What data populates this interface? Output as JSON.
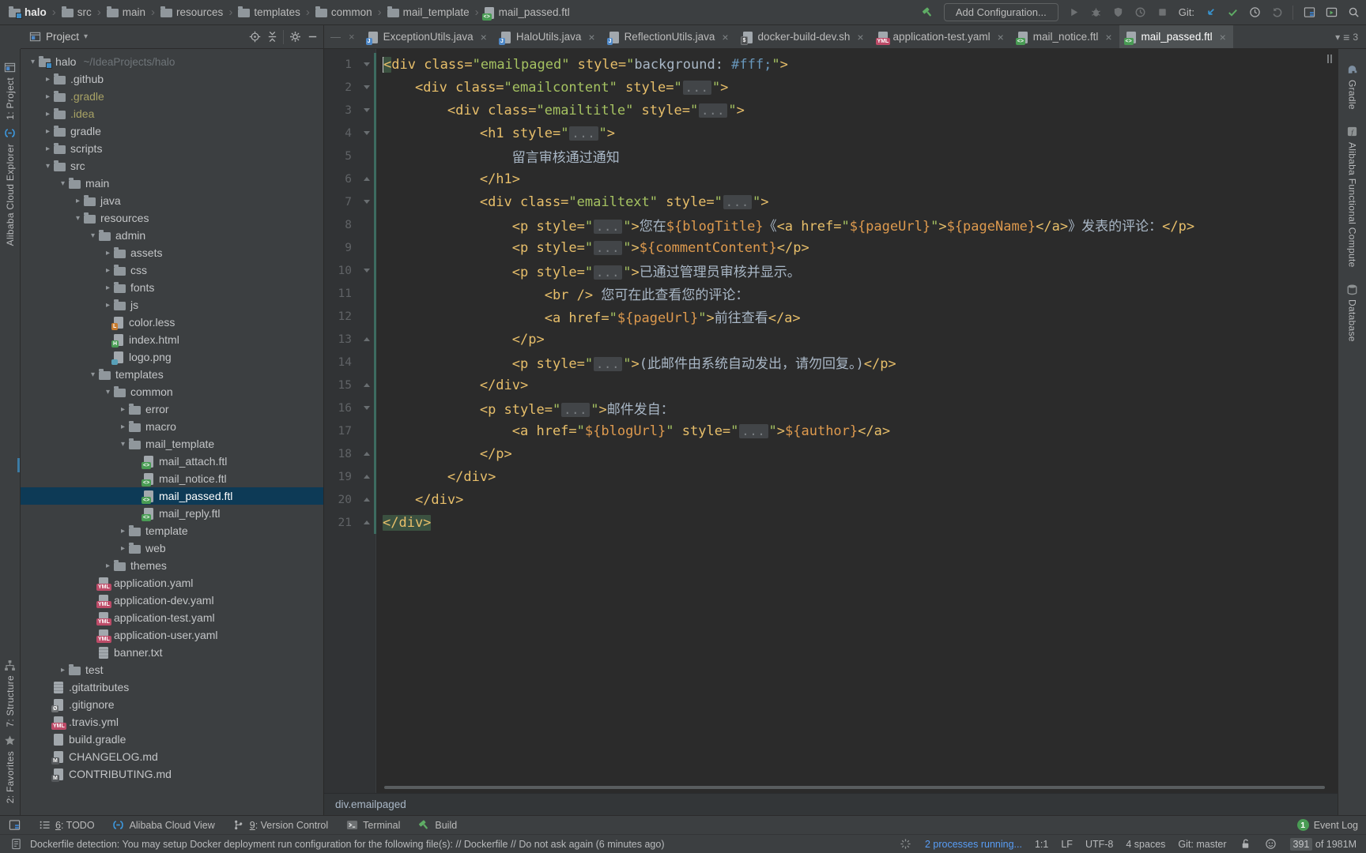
{
  "colors": {
    "ui_bg": "#3c3f41",
    "editor_bg": "#2b2b2b",
    "gutter_bg": "#313335",
    "tree_selection": "#0d3a56",
    "tab_active_bg": "#4e5254",
    "tag": "#e8bf6a",
    "string": "#a5c261",
    "plain_text": "#a9b7c6",
    "interpolation": "#de9a4e",
    "number": "#6897bb",
    "vcs_added_stripe": "#3d6b60",
    "accent_green": "#499C54",
    "accent_blue": "#3d9ae1",
    "link_blue": "#589df6",
    "excluded_folder": "#a8a265",
    "status_red_badge": "#bd4b68"
  },
  "main_toolbar": {
    "breadcrumb": {
      "items": [
        {
          "label": "halo",
          "icon": "project-folder-icon",
          "root": true
        },
        {
          "label": "src",
          "icon": "folder-icon"
        },
        {
          "label": "main",
          "icon": "folder-icon"
        },
        {
          "label": "resources",
          "icon": "folder-icon"
        },
        {
          "label": "templates",
          "icon": "folder-icon"
        },
        {
          "label": "common",
          "icon": "folder-icon"
        },
        {
          "label": "mail_template",
          "icon": "folder-icon"
        },
        {
          "label": "mail_passed.ftl",
          "icon": "file-ftl"
        }
      ]
    },
    "add_configuration": "Add Configuration...",
    "git_label": "Git:"
  },
  "tab_bar": {
    "remnant_close": "×",
    "tabs": [
      {
        "label": "ExceptionUtils.java",
        "icon": "file-java",
        "close": "×"
      },
      {
        "label": "HaloUtils.java",
        "icon": "file-java",
        "close": "×"
      },
      {
        "label": "ReflectionUtils.java",
        "icon": "file-java",
        "close": "×"
      },
      {
        "label": "docker-build-dev.sh",
        "icon": "file-sh",
        "close": "×"
      },
      {
        "label": "application-test.yaml",
        "icon": "file-yml",
        "close": "×"
      },
      {
        "label": "mail_notice.ftl",
        "icon": "file-ftl",
        "close": "×"
      },
      {
        "label": "mail_passed.ftl",
        "icon": "file-ftl",
        "close": "×",
        "active": true
      }
    ],
    "overflow": {
      "arrow": "▾",
      "count": "3"
    }
  },
  "project_panel": {
    "header": {
      "title": "Project",
      "caret": "▾"
    },
    "tree": [
      {
        "label": "halo",
        "level": 0,
        "icon": "project-folder-icon",
        "arrow": "exp",
        "hint": "~/IdeaProjects/halo"
      },
      {
        "label": ".github",
        "level": 1,
        "icon": "folder-icon",
        "arrow": "col"
      },
      {
        "label": ".gradle",
        "level": 1,
        "icon": "folder-icon",
        "arrow": "col",
        "excluded": true
      },
      {
        "label": ".idea",
        "level": 1,
        "icon": "folder-icon",
        "arrow": "col",
        "excluded": true
      },
      {
        "label": "gradle",
        "level": 1,
        "icon": "folder-icon",
        "arrow": "col"
      },
      {
        "label": "scripts",
        "level": 1,
        "icon": "folder-icon",
        "arrow": "col"
      },
      {
        "label": "src",
        "level": 1,
        "icon": "folder-icon",
        "arrow": "exp"
      },
      {
        "label": "main",
        "level": 2,
        "icon": "folder-icon",
        "arrow": "exp"
      },
      {
        "label": "java",
        "level": 3,
        "icon": "folder-icon",
        "arrow": "col"
      },
      {
        "label": "resources",
        "level": 3,
        "icon": "folder-icon",
        "arrow": "exp"
      },
      {
        "label": "admin",
        "level": 4,
        "icon": "folder-icon",
        "arrow": "exp"
      },
      {
        "label": "assets",
        "level": 5,
        "icon": "folder-icon",
        "arrow": "col"
      },
      {
        "label": "css",
        "level": 5,
        "icon": "folder-icon",
        "arrow": "col"
      },
      {
        "label": "fonts",
        "level": 5,
        "icon": "folder-icon",
        "arrow": "col"
      },
      {
        "label": "js",
        "level": 5,
        "icon": "folder-icon",
        "arrow": "col"
      },
      {
        "label": "color.less",
        "level": 5,
        "icon": "file-less"
      },
      {
        "label": "index.html",
        "level": 5,
        "icon": "file-html"
      },
      {
        "label": "logo.png",
        "level": 5,
        "icon": "file-img"
      },
      {
        "label": "templates",
        "level": 4,
        "icon": "folder-icon",
        "arrow": "exp"
      },
      {
        "label": "common",
        "level": 5,
        "icon": "folder-icon",
        "arrow": "exp"
      },
      {
        "label": "error",
        "level": 6,
        "icon": "folder-icon",
        "arrow": "col"
      },
      {
        "label": "macro",
        "level": 6,
        "icon": "folder-icon",
        "arrow": "col"
      },
      {
        "label": "mail_template",
        "level": 6,
        "icon": "folder-icon",
        "arrow": "exp"
      },
      {
        "label": "mail_attach.ftl",
        "level": 7,
        "icon": "file-ftl"
      },
      {
        "label": "mail_notice.ftl",
        "level": 7,
        "icon": "file-ftl"
      },
      {
        "label": "mail_passed.ftl",
        "level": 7,
        "icon": "file-ftl",
        "selected": true
      },
      {
        "label": "mail_reply.ftl",
        "level": 7,
        "icon": "file-ftl"
      },
      {
        "label": "template",
        "level": 6,
        "icon": "folder-icon",
        "arrow": "col"
      },
      {
        "label": "web",
        "level": 6,
        "icon": "folder-icon",
        "arrow": "col"
      },
      {
        "label": "themes",
        "level": 5,
        "icon": "folder-icon",
        "arrow": "col"
      },
      {
        "label": "application.yaml",
        "level": 4,
        "icon": "file-yml"
      },
      {
        "label": "application-dev.yaml",
        "level": 4,
        "icon": "file-yml"
      },
      {
        "label": "application-test.yaml",
        "level": 4,
        "icon": "file-yml"
      },
      {
        "label": "application-user.yaml",
        "level": 4,
        "icon": "file-yml"
      },
      {
        "label": "banner.txt",
        "level": 4,
        "icon": "file-txt"
      },
      {
        "label": "test",
        "level": 2,
        "icon": "folder-icon",
        "arrow": "col"
      },
      {
        "label": ".gitattributes",
        "level": 1,
        "icon": "file-txt"
      },
      {
        "label": ".gitignore",
        "level": 1,
        "icon": "file-ignore"
      },
      {
        "label": ".travis.yml",
        "level": 1,
        "icon": "file-yml"
      },
      {
        "label": "build.gradle",
        "level": 1,
        "icon": "file-gradle"
      },
      {
        "label": "CHANGELOG.md",
        "level": 1,
        "icon": "file-md"
      },
      {
        "label": "CONTRIBUTING.md",
        "level": 1,
        "icon": "file-md"
      }
    ]
  },
  "editor": {
    "breadcrumb": "div.emailpaged",
    "lines": [
      {
        "num": "1",
        "fold": "start",
        "ind": 0,
        "caret": true,
        "seg": [
          [
            "hl",
            "<"
          ],
          [
            "g",
            "div class="
          ],
          [
            "s",
            "\"emailpaged\""
          ],
          [
            "g",
            " style="
          ],
          [
            "s",
            "\""
          ],
          [
            "c",
            "background: "
          ],
          [
            "n",
            "#fff;"
          ],
          [
            "s",
            "\""
          ],
          [
            "g",
            ">"
          ]
        ]
      },
      {
        "num": "2",
        "fold": "start",
        "ind": 1,
        "seg": [
          [
            "g",
            "<div class="
          ],
          [
            "s",
            "\"emailcontent\""
          ],
          [
            "g",
            " style="
          ],
          [
            "s",
            "\""
          ],
          [
            "f",
            "..."
          ],
          [
            "s",
            "\""
          ],
          [
            "g",
            ">"
          ]
        ]
      },
      {
        "num": "3",
        "fold": "start",
        "ind": 2,
        "seg": [
          [
            "g",
            "<div class="
          ],
          [
            "s",
            "\"emailtitle\""
          ],
          [
            "g",
            " style="
          ],
          [
            "s",
            "\""
          ],
          [
            "f",
            "..."
          ],
          [
            "s",
            "\""
          ],
          [
            "g",
            ">"
          ]
        ]
      },
      {
        "num": "4",
        "fold": "start",
        "ind": 3,
        "seg": [
          [
            "g",
            "<h1 style="
          ],
          [
            "s",
            "\""
          ],
          [
            "f",
            "..."
          ],
          [
            "s",
            "\""
          ],
          [
            "g",
            ">"
          ]
        ]
      },
      {
        "num": "5",
        "fold": "none",
        "ind": 4,
        "seg": [
          [
            "t",
            "留言审核通过通知"
          ]
        ]
      },
      {
        "num": "6",
        "fold": "end",
        "ind": 3,
        "seg": [
          [
            "g",
            "</h1>"
          ]
        ]
      },
      {
        "num": "7",
        "fold": "start",
        "ind": 3,
        "seg": [
          [
            "g",
            "<div class="
          ],
          [
            "s",
            "\"emailtext\""
          ],
          [
            "g",
            " style="
          ],
          [
            "s",
            "\""
          ],
          [
            "f",
            "..."
          ],
          [
            "s",
            "\""
          ],
          [
            "g",
            ">"
          ]
        ]
      },
      {
        "num": "8",
        "fold": "none",
        "ind": 4,
        "seg": [
          [
            "g",
            "<p style="
          ],
          [
            "s",
            "\""
          ],
          [
            "f",
            "..."
          ],
          [
            "s",
            "\""
          ],
          [
            "g",
            ">"
          ],
          [
            "t",
            "您在"
          ],
          [
            "i",
            "${blogTitle}"
          ],
          [
            "t",
            "《"
          ],
          [
            "g",
            "<a href="
          ],
          [
            "s",
            "\""
          ],
          [
            "i",
            "${pageUrl}"
          ],
          [
            "s",
            "\""
          ],
          [
            "g",
            ">"
          ],
          [
            "i",
            "${pageName}"
          ],
          [
            "g",
            "</a>"
          ],
          [
            "t",
            "》发表的评论："
          ],
          [
            "g",
            "</p>"
          ]
        ]
      },
      {
        "num": "9",
        "fold": "none",
        "ind": 4,
        "seg": [
          [
            "g",
            "<p style="
          ],
          [
            "s",
            "\""
          ],
          [
            "f",
            "..."
          ],
          [
            "s",
            "\""
          ],
          [
            "g",
            ">"
          ],
          [
            "i",
            "${commentContent}"
          ],
          [
            "g",
            "</p>"
          ]
        ]
      },
      {
        "num": "10",
        "fold": "start",
        "ind": 4,
        "seg": [
          [
            "g",
            "<p style="
          ],
          [
            "s",
            "\""
          ],
          [
            "f",
            "..."
          ],
          [
            "s",
            "\""
          ],
          [
            "g",
            ">"
          ],
          [
            "t",
            "已通过管理员审核并显示。"
          ]
        ]
      },
      {
        "num": "11",
        "fold": "none",
        "ind": 5,
        "seg": [
          [
            "g",
            "<br />"
          ],
          [
            "t",
            " 您可在此查看您的评论："
          ]
        ]
      },
      {
        "num": "12",
        "fold": "none",
        "ind": 5,
        "seg": [
          [
            "g",
            "<a href="
          ],
          [
            "s",
            "\""
          ],
          [
            "i",
            "${pageUrl}"
          ],
          [
            "s",
            "\""
          ],
          [
            "g",
            ">"
          ],
          [
            "t",
            "前往查看"
          ],
          [
            "g",
            "</a>"
          ]
        ]
      },
      {
        "num": "13",
        "fold": "end",
        "ind": 4,
        "seg": [
          [
            "g",
            "</p>"
          ]
        ]
      },
      {
        "num": "14",
        "fold": "none",
        "ind": 4,
        "seg": [
          [
            "g",
            "<p style="
          ],
          [
            "s",
            "\""
          ],
          [
            "f",
            "..."
          ],
          [
            "s",
            "\""
          ],
          [
            "g",
            ">"
          ],
          [
            "t",
            "(此邮件由系统自动发出，请勿回复。)"
          ],
          [
            "g",
            "</p>"
          ]
        ]
      },
      {
        "num": "15",
        "fold": "end",
        "ind": 3,
        "seg": [
          [
            "g",
            "</div>"
          ]
        ]
      },
      {
        "num": "16",
        "fold": "start",
        "ind": 3,
        "seg": [
          [
            "g",
            "<p style="
          ],
          [
            "s",
            "\""
          ],
          [
            "f",
            "..."
          ],
          [
            "s",
            "\""
          ],
          [
            "g",
            ">"
          ],
          [
            "t",
            "邮件发自："
          ]
        ]
      },
      {
        "num": "17",
        "fold": "none",
        "ind": 4,
        "seg": [
          [
            "g",
            "<a href="
          ],
          [
            "s",
            "\""
          ],
          [
            "i",
            "${blogUrl}"
          ],
          [
            "s",
            "\""
          ],
          [
            "g",
            " style="
          ],
          [
            "s",
            "\""
          ],
          [
            "f",
            "..."
          ],
          [
            "s",
            "\""
          ],
          [
            "g",
            ">"
          ],
          [
            "i",
            "${author}"
          ],
          [
            "g",
            "</a>"
          ]
        ]
      },
      {
        "num": "18",
        "fold": "end",
        "ind": 3,
        "seg": [
          [
            "g",
            "</p>"
          ]
        ]
      },
      {
        "num": "19",
        "fold": "end",
        "ind": 2,
        "seg": [
          [
            "g",
            "</div>"
          ]
        ]
      },
      {
        "num": "20",
        "fold": "end",
        "ind": 1,
        "seg": [
          [
            "g",
            "</div>"
          ]
        ]
      },
      {
        "num": "21",
        "fold": "end",
        "ind": 0,
        "seg": [
          [
            "hl",
            "</div>"
          ]
        ]
      }
    ]
  },
  "left_stripe": {
    "top": [
      {
        "label": "1: Project",
        "icon": "project-tool-icon"
      },
      {
        "label": "Alibaba Cloud Explorer",
        "icon": "alibaba-icon"
      }
    ],
    "bottom": [
      {
        "label": "7: Structure",
        "icon": "structure-icon"
      },
      {
        "label": "2: Favorites",
        "icon": "favorites-star-icon"
      }
    ]
  },
  "right_stripe": [
    {
      "label": "Gradle",
      "icon": "gradle-elephant-icon"
    },
    {
      "label": "Alibaba Functional Compute",
      "icon": "function-compute-icon"
    },
    {
      "label": "Database",
      "icon": "database-icon"
    }
  ],
  "bottom_toolbar": {
    "items": [
      {
        "label": "6: TODO",
        "icon": "todo-list-icon",
        "underline_first": true
      },
      {
        "label": "Alibaba Cloud View",
        "icon": "alibaba-icon"
      },
      {
        "label": "9: Version Control",
        "icon": "branch-icon",
        "underline_first": true
      },
      {
        "label": "Terminal",
        "icon": "terminal-icon"
      },
      {
        "label": "Build",
        "icon": "build-hammer-icon"
      }
    ],
    "event_log": {
      "badge": "1",
      "label": "Event Log"
    }
  },
  "status_bar": {
    "message": "Dockerfile detection: You may setup Docker deployment run configuration for the following file(s): // Dockerfile // Do not ask again (6 minutes ago)",
    "processes": "2 processes running...",
    "caret_position": "1:1",
    "line_ending": "LF",
    "encoding": "UTF-8",
    "indent": "4 spaces",
    "git_branch": "Git: master",
    "memory_used": "391",
    "memory_total": "of 1981M"
  }
}
